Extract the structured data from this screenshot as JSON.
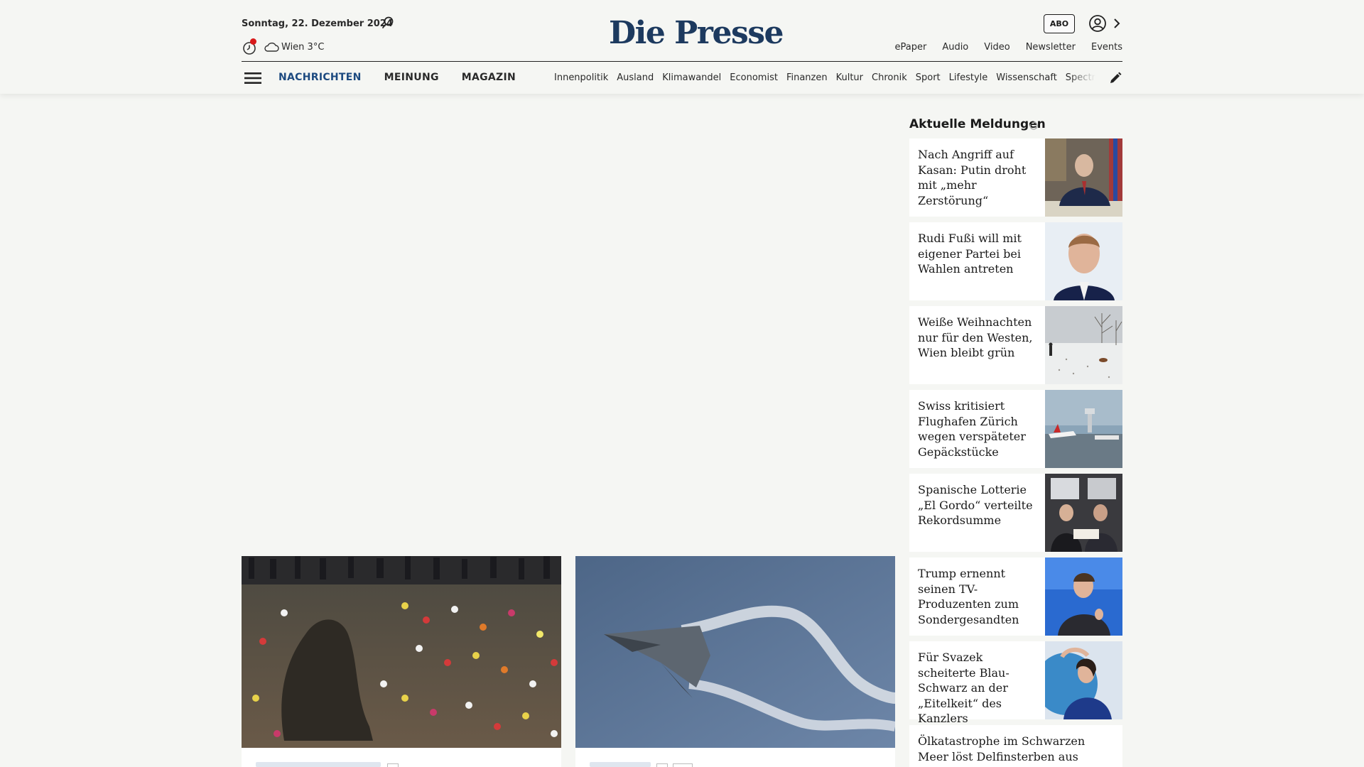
{
  "header": {
    "date": "Sonntag, 22. Dezember 2024",
    "weather": "Wien 3°C",
    "logo": "Die Presse",
    "abo_label": "ABO",
    "quicklinks": [
      "ePaper",
      "Audio",
      "Video",
      "Newsletter",
      "Events"
    ]
  },
  "nav": {
    "main": [
      {
        "label": "NACHRICHTEN",
        "active": true
      },
      {
        "label": "MEINUNG",
        "active": false
      },
      {
        "label": "MAGAZIN",
        "active": false
      }
    ],
    "sub": [
      "Innenpolitik",
      "Ausland",
      "Klimawandel",
      "Economist",
      "Finanzen",
      "Kultur",
      "Chronik",
      "Sport",
      "Lifestyle",
      "Wissenschaft",
      "Spectrum"
    ]
  },
  "sidebar": {
    "title": "Aktuelle Meldungen",
    "items": [
      {
        "headline": "Nach Angriff auf Kasan: Putin droht mit „mehr Zerstörung“",
        "image": "putin-photo"
      },
      {
        "headline": "Rudi Fußi will mit eigener Partei bei Wahlen antreten",
        "image": "portrait-photo"
      },
      {
        "headline": "Weiße Weihnachten nur für den Westen, Wien bleibt grün",
        "image": "winter-landscape-photo"
      },
      {
        "headline": "Swiss kritisiert Flughafen Zürich wegen verspäteter Gepäckstücke",
        "image": "airport-photo"
      },
      {
        "headline": "Spanische Lotterie „El Gordo“ verteilte Rekordsumme",
        "image": "lottery-photo"
      },
      {
        "headline": "Trump ernennt seinen TV-Produzenten zum Sondergesandten",
        "image": "tv-producer-photo"
      },
      {
        "headline": "Für Svazek scheiterte Blau-Schwarz an der „Eitelkeit“ des Kanzlers",
        "image": "politician-photo"
      },
      {
        "headline": "Ölkatastrophe im Schwarzen Meer löst Delfinsterben aus",
        "image": ""
      }
    ]
  },
  "main": {
    "cards": [
      {
        "image": "memorial-flowers-photo"
      },
      {
        "image": "fighter-jet-photo"
      }
    ]
  },
  "colors": {
    "brand": "#1d3a5f",
    "nav_active": "#1d4a80",
    "background": "#f5f6f3",
    "alert": "#d81b1b"
  }
}
